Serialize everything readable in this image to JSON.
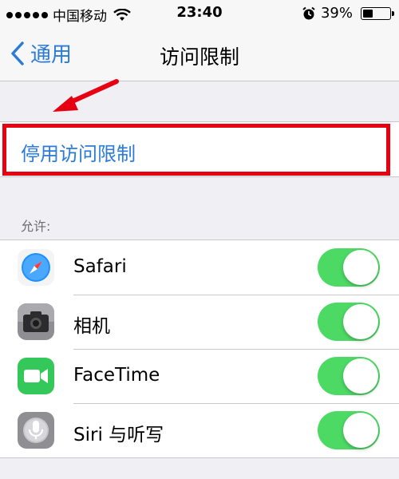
{
  "status_bar": {
    "carrier": "中国移动",
    "time": "23:40",
    "battery_percent": "39%",
    "battery_level": 0.39
  },
  "nav": {
    "back_label": "通用",
    "title": "访问限制"
  },
  "disable_restrictions_label": "停用访问限制",
  "allow_section_header": "允许:",
  "apps": [
    {
      "label": "Safari",
      "icon": "safari-icon",
      "enabled": true
    },
    {
      "label": "相机",
      "icon": "camera-icon",
      "enabled": true
    },
    {
      "label": "FaceTime",
      "icon": "facetime-icon",
      "enabled": true
    },
    {
      "label": "Siri 与听写",
      "icon": "siri-icon",
      "enabled": true
    }
  ],
  "colors": {
    "accent": "#2b7bd8",
    "toggle_on": "#4cd964",
    "highlight": "#e60012"
  }
}
